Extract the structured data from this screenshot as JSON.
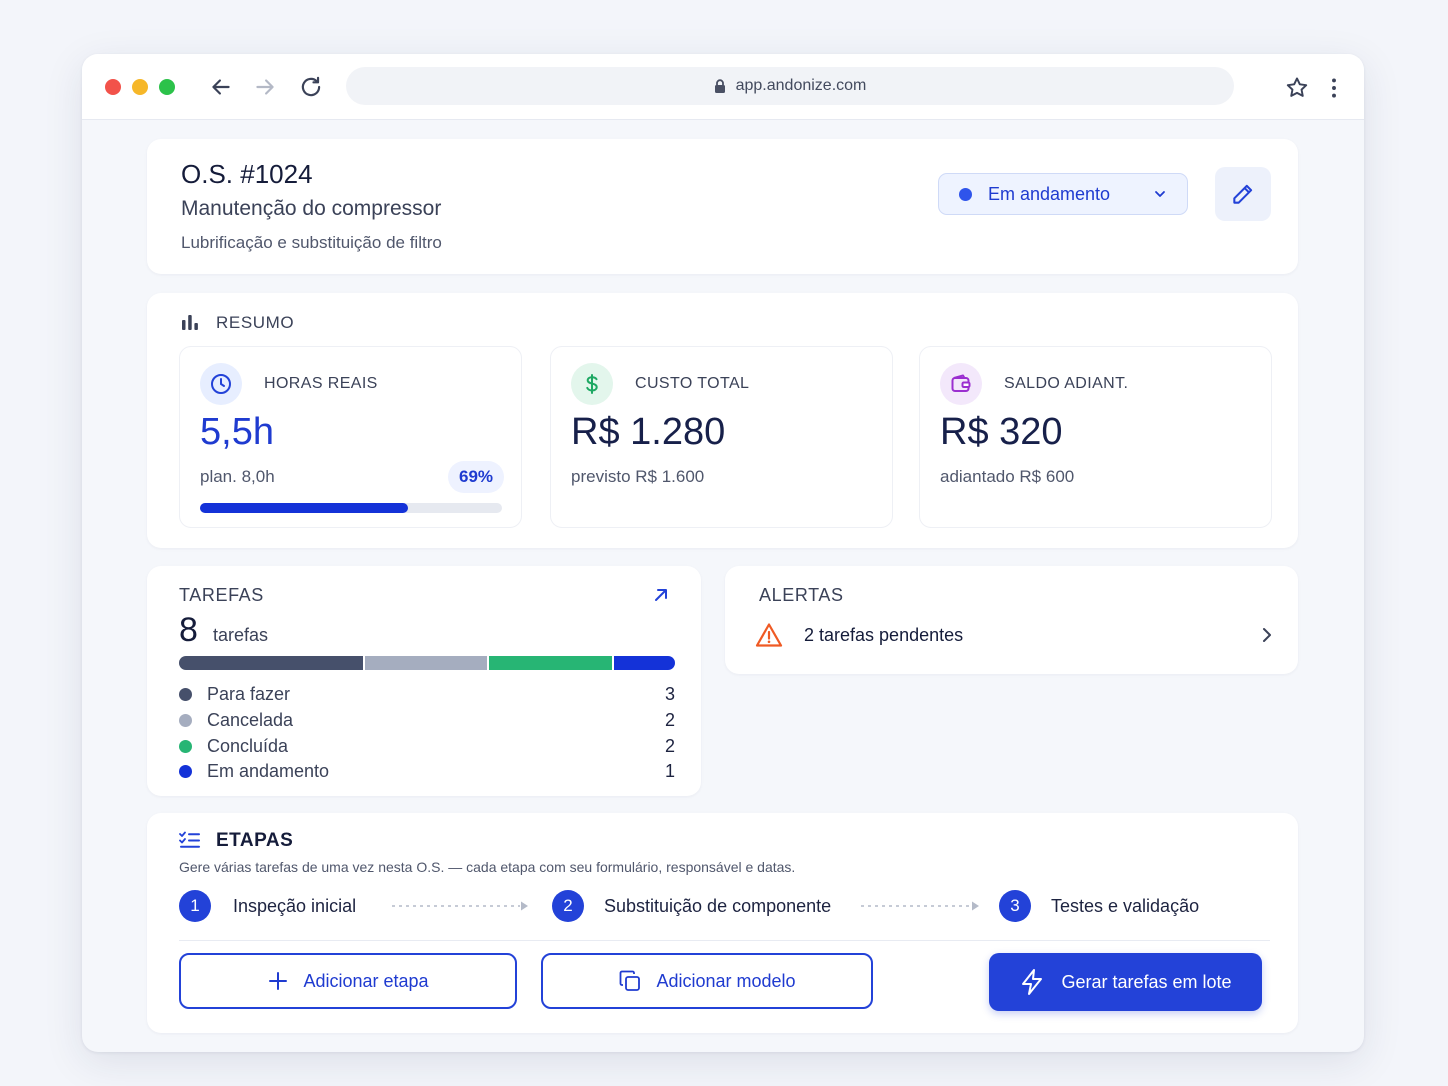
{
  "browser": {
    "url": "app.andonize.com"
  },
  "order": {
    "number": "O.S. #1024",
    "title": "Manutenção do compressor",
    "description": "Lubrificação e substituição de filtro",
    "status_label": "Em andamento",
    "status_color": "#2f54eb"
  },
  "summary": {
    "heading": "RESUMO",
    "hours": {
      "label": "HORAS REAIS",
      "value": "5,5h",
      "sub": "plan. 8,0h",
      "percent_label": "69%",
      "progress": 0.69,
      "icon": "clock-icon"
    },
    "cost": {
      "label": "CUSTO TOTAL",
      "value": "R$ 1.280",
      "sub": "previsto R$ 1.600",
      "icon": "dollar-icon"
    },
    "balance": {
      "label": "SALDO ADIANT.",
      "value": "R$ 320",
      "sub": "adiantado R$ 600",
      "icon": "wallet-icon"
    }
  },
  "tasks": {
    "heading": "TAREFAS",
    "count": "8",
    "count_label": "tarefas",
    "breakdown": [
      {
        "label": "Para fazer",
        "count": "3",
        "value": 3,
        "color": "#46506b"
      },
      {
        "label": "Cancelada",
        "count": "2",
        "value": 2,
        "color": "#a5adbf"
      },
      {
        "label": "Concluída",
        "count": "2",
        "value": 2,
        "color": "#27b574"
      },
      {
        "label": "Em andamento",
        "count": "1",
        "value": 1,
        "color": "#1432d8"
      }
    ]
  },
  "alerts": {
    "heading": "ALERTAS",
    "message": "2 tarefas pendentes",
    "icon": "warning-icon"
  },
  "stages": {
    "heading": "ETAPAS",
    "description": "Gere várias tarefas de uma vez nesta O.S. — cada etapa com seu formulário, responsável e datas.",
    "steps": [
      {
        "num": "1",
        "label": "Inspeção inicial"
      },
      {
        "num": "2",
        "label": "Substituição de componente"
      },
      {
        "num": "3",
        "label": "Testes e validação"
      }
    ],
    "add_stage_label": "Adicionar etapa",
    "add_template_label": "Adicionar modelo",
    "generate_label": "Gerar tarefas em lote"
  }
}
